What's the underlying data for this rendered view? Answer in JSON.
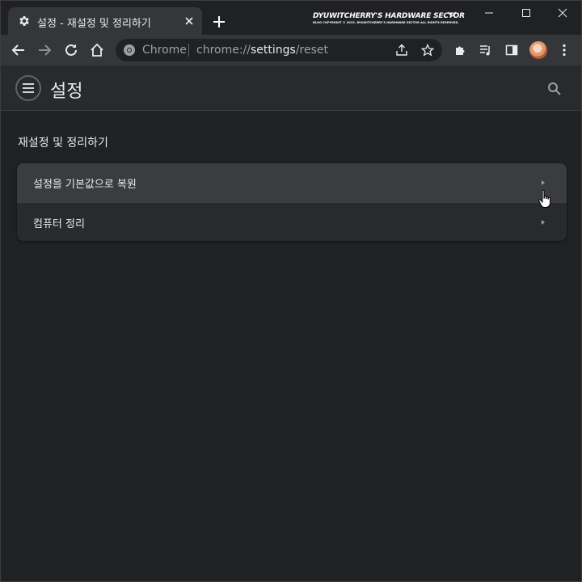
{
  "tab": {
    "title": "설정 - 재설정 및 정리하기",
    "icon": "gear-icon"
  },
  "watermark": {
    "title": "DYUWITCHERRY'S HARDWARE SECTOR",
    "subtitle": "BLOG COPYRIGHT © 2015. DYUWITCHERRY'S HARDWARE SECTOR ALL RIGHTS RESERVED."
  },
  "omnibox": {
    "chip": "Chrome",
    "url_scheme": "chrome://",
    "url_host": "settings",
    "url_path": "/reset"
  },
  "settings": {
    "title": "설정"
  },
  "section": {
    "title": "재설정 및 정리하기"
  },
  "rows": [
    {
      "label": "설정을 기본값으로 복원"
    },
    {
      "label": "컴퓨터 정리"
    }
  ],
  "colors": {
    "background": "#202124",
    "card": "#292a2d",
    "hover_row": "#3b3c3f",
    "text": "#e8eaed"
  }
}
